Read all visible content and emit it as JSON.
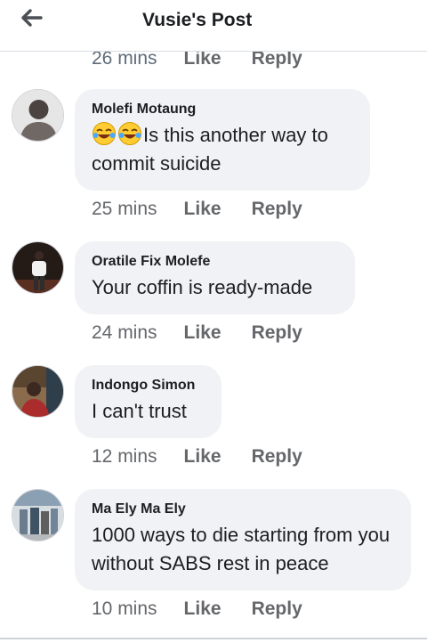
{
  "header": {
    "title": "Vusie's Post"
  },
  "top_row": {
    "time": "26 mins",
    "like": "Like",
    "reply": "Reply"
  },
  "comments": [
    {
      "author": "Molefi Motaung",
      "text": "Is this another way to commit suicide",
      "emoji": [
        "tears-of-joy-icon",
        "tears-of-joy-icon"
      ],
      "time": "25 mins",
      "like": "Like",
      "reply": "Reply"
    },
    {
      "author": "Oratile Fix Molefe",
      "text": "Your coffin is ready-made",
      "time": "24 mins",
      "like": "Like",
      "reply": "Reply"
    },
    {
      "author": "Indongo Simon",
      "text": "I can't trust",
      "time": "12 mins",
      "like": "Like",
      "reply": "Reply"
    },
    {
      "author": "Ma Ely Ma Ely",
      "text": "1000 ways to die starting from you without SABS rest in peace",
      "time": "10 mins",
      "like": "Like",
      "reply": "Reply"
    }
  ],
  "colors": {
    "bubble_bg": "#f0f2f5",
    "meta_text": "#65676b",
    "divider": "#dadde1"
  }
}
